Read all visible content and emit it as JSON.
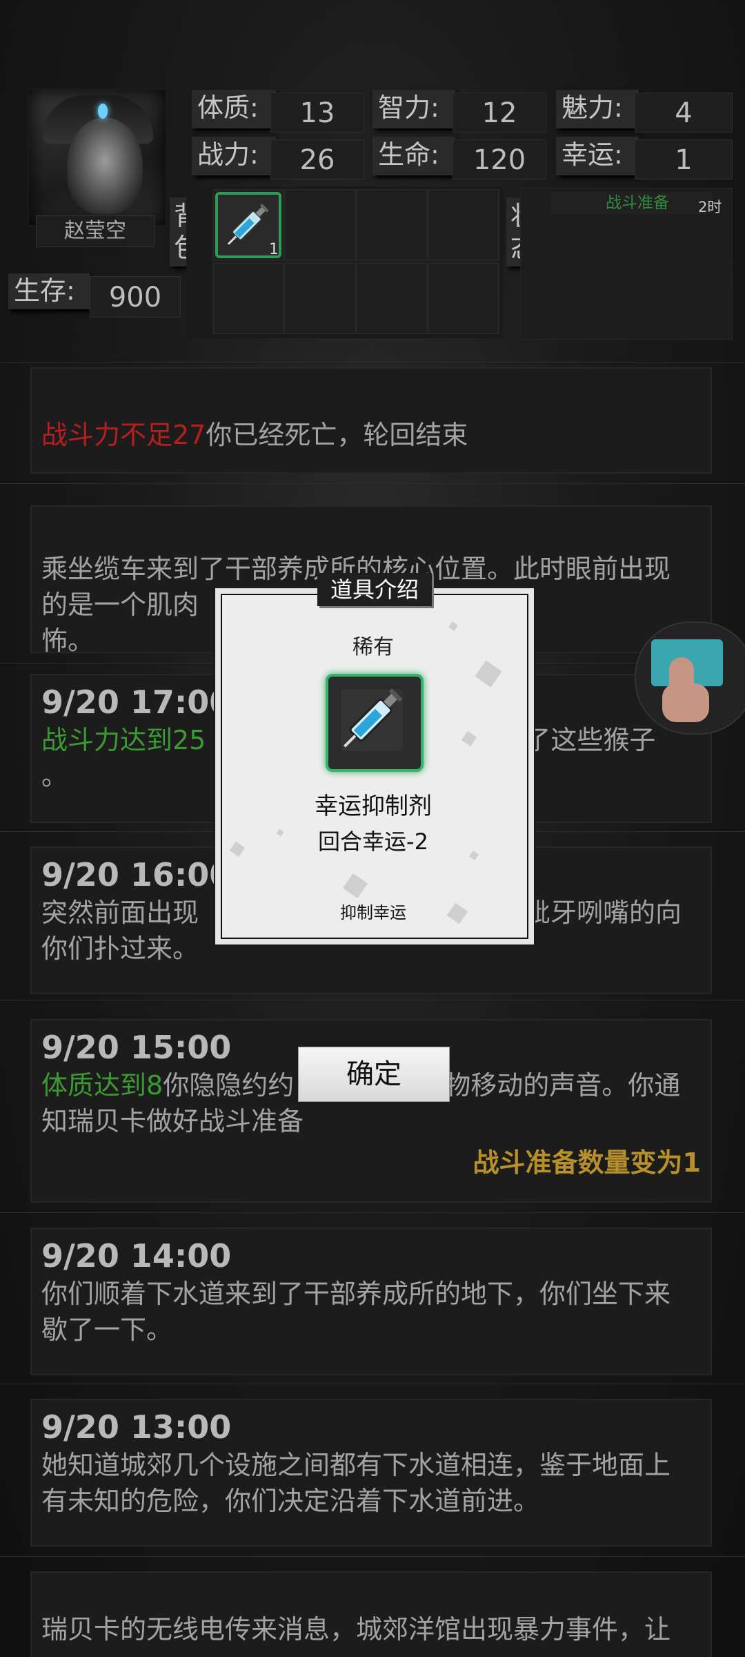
{
  "character": {
    "name": "赵莹空",
    "stats": [
      {
        "label": "体质:",
        "value": "13"
      },
      {
        "label": "智力:",
        "value": "12"
      },
      {
        "label": "魅力:",
        "value": "4"
      },
      {
        "label": "战力:",
        "value": "26"
      },
      {
        "label": "生命:",
        "value": "120"
      },
      {
        "label": "幸运:",
        "value": "1"
      }
    ],
    "survive_label": "生存:",
    "survive_value": "900"
  },
  "bag": {
    "label_1": "背",
    "label_2": "包",
    "items": [
      {
        "icon": "syringe-icon",
        "count": "1"
      }
    ]
  },
  "status": {
    "label_1": "状",
    "label_2": "态",
    "items": [
      {
        "name": "战斗准备",
        "time": "2时",
        "color": "#2e8b3e"
      }
    ]
  },
  "log": {
    "card0": {
      "highlight": "战斗力不足27",
      "text": "你已经死亡，轮回结束"
    },
    "card1": {
      "text_line1": "乘坐缆车来到了干部养成所的核心位置。此时眼前出现",
      "text_line2_a": "的是一个肌肉",
      "text_line2_b": "怖。"
    },
    "card2": {
      "time": "9/20 17:00",
      "highlight": "战斗力达到25",
      "text_tail": "退了这些猴子",
      "line2": "。"
    },
    "card3": {
      "time": "9/20 16:00",
      "text_a": "突然前面出现",
      "text_b": "呲牙咧嘴的向",
      "line2": "你们扑过来。"
    },
    "card4": {
      "time": "9/20 15:00",
      "highlight": "体质达到8",
      "text_a": "你隐隐约约",
      "text_b": "物移动的声音。你通",
      "line2": "知瑞贝卡做好战斗准备",
      "result": "战斗准备数量变为1"
    },
    "card5": {
      "time": "9/20 14:00",
      "line1": "你们顺着下水道来到了干部养成所的地下，你们坐下来",
      "line2": "歇了一下。"
    },
    "card6": {
      "time": "9/20 13:00",
      "line1": "她知道城郊几个设施之间都有下水道相连，鉴于地面上",
      "line2": "有未知的危险，你们决定沿着下水道前进。"
    },
    "card7": {
      "line1": "瑞贝卡的无线电传来消息，城郊洋馆出现暴力事件，让"
    }
  },
  "colors": {
    "red": "#b81e1e",
    "green": "#3c9a33",
    "gold": "#b8902a",
    "rare_border": "#39b36a"
  },
  "modal": {
    "title": "道具介绍",
    "rarity": "稀有",
    "item_icon": "syringe-icon",
    "item_name": "幸运抑制剂",
    "effect": "回合幸运-2",
    "description": "抑制幸运",
    "confirm": "确定"
  },
  "floating_button": {
    "icon": "tap-finger-icon"
  }
}
